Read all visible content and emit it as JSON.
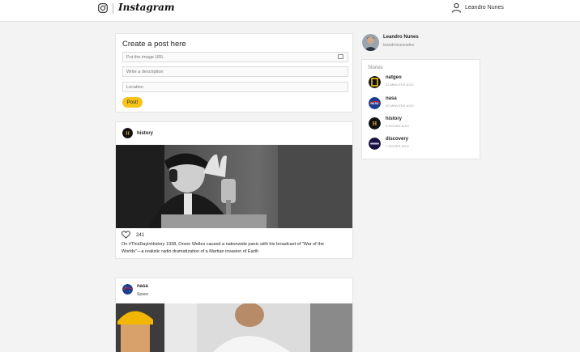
{
  "header": {
    "brand": "Instagram",
    "user_name": "Leandro Nunes"
  },
  "create_post": {
    "title": "Create a post here",
    "image_url_placeholder": "Put the image URL",
    "description_placeholder": "Write a description",
    "location_placeholder": "Location",
    "submit_label": "Post!"
  },
  "posts": [
    {
      "user": "history",
      "location": "",
      "likes": "241",
      "caption": "On #ThisDayinHistory 1938, Orson Welles caused a nationwide panic with his broadcast of \"War of the Worlds\"—a realistic radio dramatization of a Martian invasion of Earth"
    },
    {
      "user": "nasa",
      "location": "Space"
    }
  ],
  "profile": {
    "name": "Leandro Nunes",
    "handle": "leandronunesdev"
  },
  "stories": {
    "title": "Stories",
    "items": [
      {
        "name": "natgeo",
        "time": "22 MINUTES AGO",
        "color": "#f5c400"
      },
      {
        "name": "nasa",
        "time": "30 MINUTES AGO",
        "color": "#1b3c8f"
      },
      {
        "name": "history",
        "time": "3 HOURS AGO",
        "color": "#111111"
      },
      {
        "name": "discovery",
        "time": "7 HOURS AGO",
        "color": "#1a1140"
      }
    ]
  },
  "colors": {
    "accent": "#f6c318",
    "background": "#f3f3f3"
  }
}
